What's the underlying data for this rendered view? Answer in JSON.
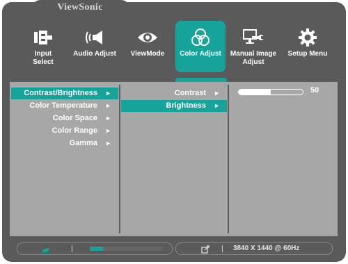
{
  "brand": "ViewSonic",
  "top_menu": [
    {
      "label_line1": "Input",
      "label_line2": "Select",
      "icon": "input-icon",
      "active": false
    },
    {
      "label_line1": "Audio Adjust",
      "label_line2": "",
      "icon": "speaker-icon",
      "active": false
    },
    {
      "label_line1": "ViewMode",
      "label_line2": "",
      "icon": "eye-icon",
      "active": false
    },
    {
      "label_line1": "Color Adjust",
      "label_line2": "",
      "icon": "color-circles-icon",
      "active": true
    },
    {
      "label_line1": "Manual Image",
      "label_line2": "Adjust",
      "icon": "monitor-wrench-icon",
      "active": false
    },
    {
      "label_line1": "Setup Menu",
      "label_line2": "",
      "icon": "gear-icon",
      "active": false
    }
  ],
  "menu_level1": [
    {
      "label": "Contrast/Brightness",
      "selected": true
    },
    {
      "label": "Color Temperature",
      "selected": false
    },
    {
      "label": "Color Space",
      "selected": false
    },
    {
      "label": "Color Range",
      "selected": false
    },
    {
      "label": "Gamma",
      "selected": false
    }
  ],
  "menu_level2": [
    {
      "label": "Contrast",
      "selected": false
    },
    {
      "label": "Brightness",
      "selected": true
    }
  ],
  "arrow_glyph": "►",
  "slider": {
    "value": "50",
    "fraction": 0.5
  },
  "status": {
    "progress_fraction": 0.18,
    "resolution": "3840 X 1440 @ 60Hz"
  },
  "colors": {
    "accent": "#16a49a",
    "panel": "#a7a7a7",
    "bezel": "#5a5a5a"
  }
}
